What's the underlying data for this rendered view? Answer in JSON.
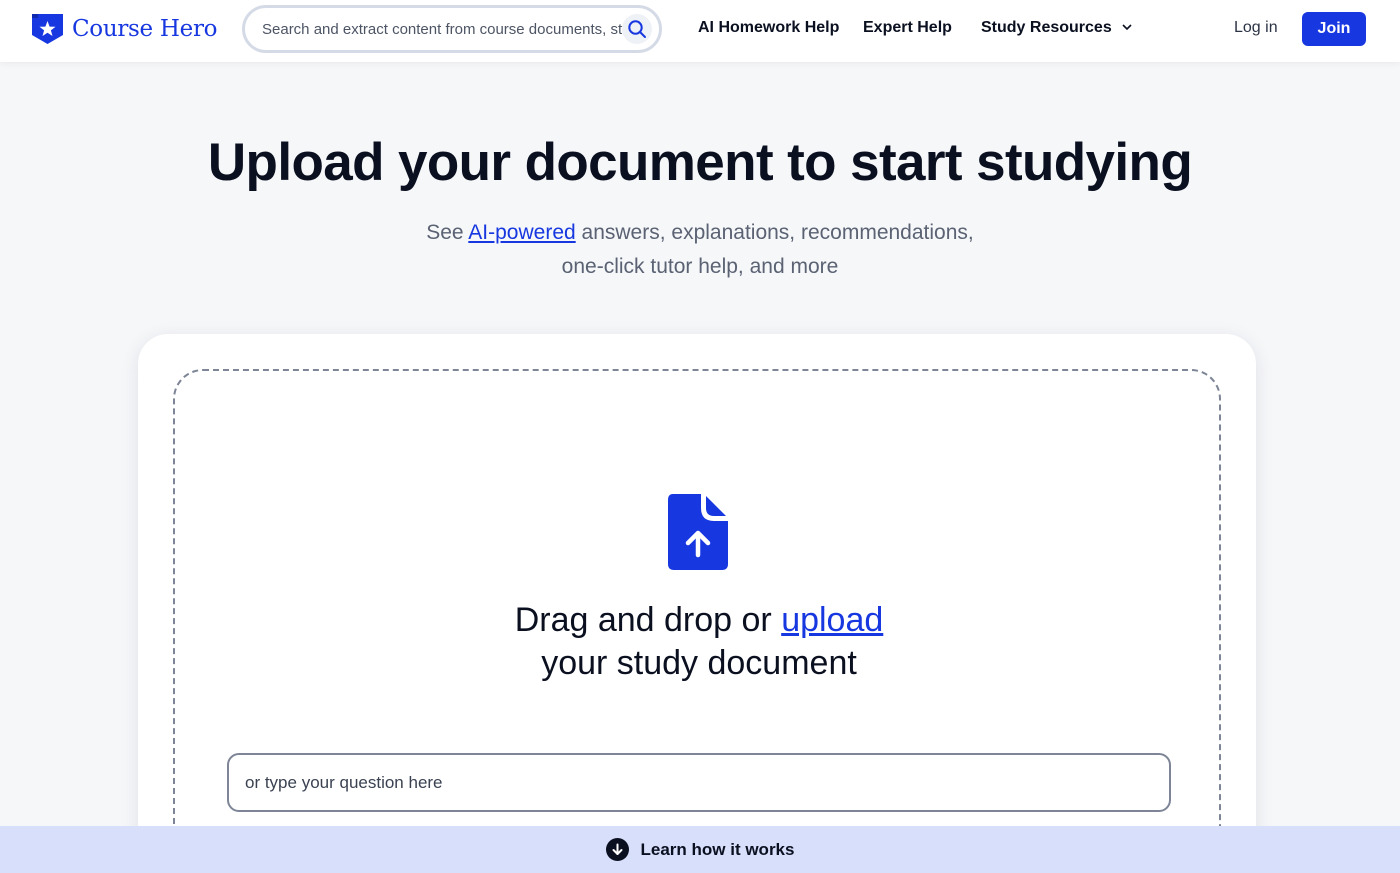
{
  "header": {
    "logo_text": "Course Hero",
    "search_placeholder": "Search and extract content from course documents, study guides & more",
    "nav": {
      "ai_homework_help": "AI Homework Help",
      "expert_help": "Expert Help",
      "study_resources": "Study Resources",
      "log_in": "Log in",
      "join": "Join"
    }
  },
  "hero": {
    "title": "Upload your document to start studying",
    "subtitle_prefix": "See ",
    "subtitle_link": "AI-powered",
    "subtitle_line1_rest": " answers, explanations, recommendations,",
    "subtitle_line2": "one-click tutor help, and more"
  },
  "upload": {
    "drag_prefix": "Drag and drop or ",
    "upload_link": "upload",
    "drag_line2": "your study document",
    "question_placeholder": "or type your question here"
  },
  "footer_bar": {
    "label": "Learn how it works"
  },
  "colors": {
    "brand": "#1737e0",
    "text": "#0b1020",
    "banner": "#d7dffb"
  }
}
